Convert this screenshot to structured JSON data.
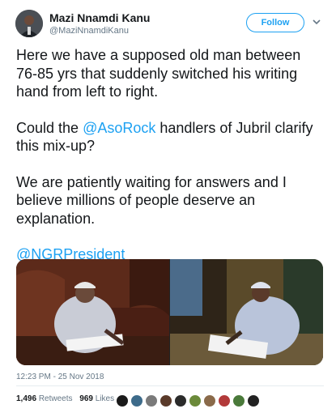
{
  "author": {
    "display_name": "Mazi Nnamdi Kanu",
    "handle": "@MaziNnamdiKanu"
  },
  "actions": {
    "follow_label": "Follow",
    "more_icon": "chevron-down-icon"
  },
  "tweet": {
    "paragraph_1": "Here we have a supposed old man between 76-85 yrs that suddenly switched his writing hand from left to right.",
    "paragraph_2_prefix": "Could the ",
    "paragraph_2_mention": "@AsoRock",
    "paragraph_2_suffix": " handlers of Jubril clarify this mix-up?",
    "paragraph_3": "We are patiently waiting for answers and I believe millions of people deserve an explanation.",
    "paragraph_4_mention": "@NGRPresident"
  },
  "timestamp": "12:23 PM - 25 Nov 2018",
  "stats": {
    "retweets_count": "1,496",
    "retweets_label": "Retweets",
    "likes_count": "969",
    "likes_label": "Likes"
  },
  "colors": {
    "accent": "#1da1f2",
    "text": "#14171a",
    "muted": "#657786"
  }
}
